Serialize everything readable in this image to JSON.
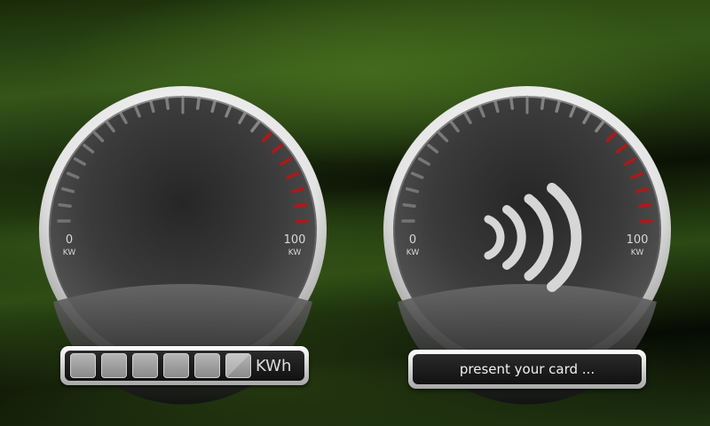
{
  "gauges": [
    {
      "min_label": "0",
      "max_label": "100",
      "min_unit": "KW",
      "max_unit": "KW"
    },
    {
      "min_label": "0",
      "max_label": "100",
      "min_unit": "KW",
      "max_unit": "KW"
    }
  ],
  "energy_display": {
    "digits": [
      "",
      "",
      "",
      "",
      "",
      ""
    ],
    "unit": "KWh"
  },
  "card_reader": {
    "status_text": "present your card ..."
  },
  "colors": {
    "tick_normal": "#9a9a9a",
    "tick_warning": "#b01818",
    "bezel": "#e8e8e8",
    "dial_face": "#2e2e2e"
  },
  "icons": {
    "contactless": "contactless-icon"
  }
}
